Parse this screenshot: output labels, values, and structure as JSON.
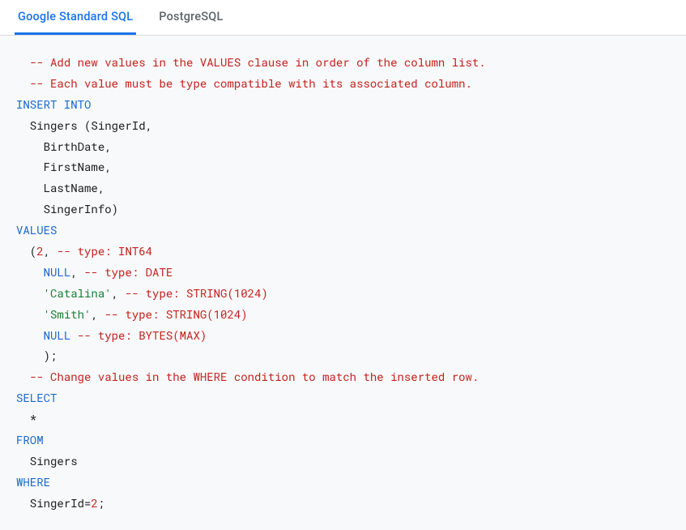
{
  "tabs": {
    "items": [
      {
        "label": "Google Standard SQL",
        "active": true
      },
      {
        "label": "PostgreSQL",
        "active": false
      }
    ]
  },
  "code": {
    "tokens": [
      {
        "t": "  ",
        "c": "text"
      },
      {
        "t": "-- Add new values in the VALUES clause in order of the column list.",
        "c": "comment"
      },
      {
        "t": "\n  ",
        "c": "text"
      },
      {
        "t": "-- Each value must be type compatible with its associated column.",
        "c": "comment"
      },
      {
        "t": "\n",
        "c": "text"
      },
      {
        "t": "INSERT INTO",
        "c": "keyword"
      },
      {
        "t": "\n  Singers (SingerId,\n    BirthDate,\n    FirstName,\n    LastName,\n    SingerInfo)\n",
        "c": "text"
      },
      {
        "t": "VALUES",
        "c": "keyword"
      },
      {
        "t": "\n  (",
        "c": "text"
      },
      {
        "t": "2",
        "c": "num"
      },
      {
        "t": ", ",
        "c": "text"
      },
      {
        "t": "-- type: INT64",
        "c": "comment"
      },
      {
        "t": "\n    ",
        "c": "text"
      },
      {
        "t": "NULL",
        "c": "null"
      },
      {
        "t": ", ",
        "c": "text"
      },
      {
        "t": "-- type: DATE",
        "c": "comment"
      },
      {
        "t": "\n    ",
        "c": "text"
      },
      {
        "t": "'Catalina'",
        "c": "str"
      },
      {
        "t": ", ",
        "c": "text"
      },
      {
        "t": "-- type: STRING(1024)",
        "c": "comment"
      },
      {
        "t": "\n    ",
        "c": "text"
      },
      {
        "t": "'Smith'",
        "c": "str"
      },
      {
        "t": ", ",
        "c": "text"
      },
      {
        "t": "-- type: STRING(1024)",
        "c": "comment"
      },
      {
        "t": "\n    ",
        "c": "text"
      },
      {
        "t": "NULL",
        "c": "null"
      },
      {
        "t": " ",
        "c": "text"
      },
      {
        "t": "-- type: BYTES(MAX)",
        "c": "comment"
      },
      {
        "t": "\n    );\n  ",
        "c": "text"
      },
      {
        "t": "-- Change values in the WHERE condition to match the inserted row.",
        "c": "comment"
      },
      {
        "t": "\n",
        "c": "text"
      },
      {
        "t": "SELECT",
        "c": "keyword"
      },
      {
        "t": "\n  *\n",
        "c": "text"
      },
      {
        "t": "FROM",
        "c": "keyword"
      },
      {
        "t": "\n  Singers\n",
        "c": "text"
      },
      {
        "t": "WHERE",
        "c": "keyword"
      },
      {
        "t": "\n  SingerId=",
        "c": "text"
      },
      {
        "t": "2",
        "c": "num"
      },
      {
        "t": ";",
        "c": "text"
      }
    ]
  }
}
